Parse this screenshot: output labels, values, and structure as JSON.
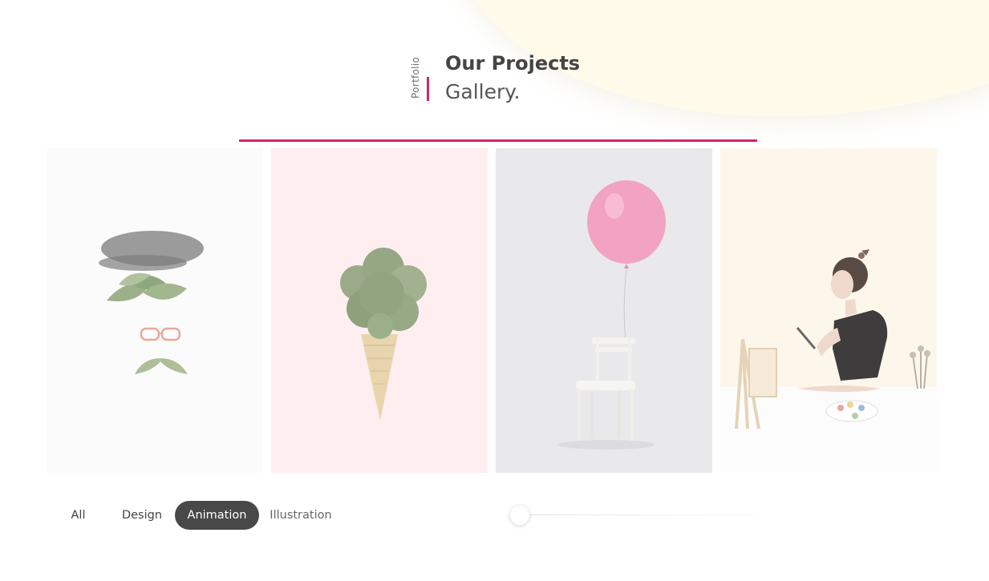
{
  "heading": {
    "vertical_label": "Portfolio",
    "title": "Our Projects",
    "subtitle": "Gallery."
  },
  "colors": {
    "accent": "#d4246f",
    "active_filter_bg": "#484848",
    "blob": "#fffaea"
  },
  "gallery": {
    "items": [
      {
        "icon": "beret-leaves-glasses-mustache-image"
      },
      {
        "icon": "broccoli-ice-cream-cone-image"
      },
      {
        "icon": "pink-balloon-chair-image"
      },
      {
        "icon": "woman-painting-easel-image"
      }
    ]
  },
  "filters": {
    "items": [
      {
        "label": "All",
        "active": false
      },
      {
        "label": "Design",
        "active": false
      },
      {
        "label": "Animation",
        "active": true
      },
      {
        "label": "Illustration",
        "active": false
      }
    ]
  },
  "slider": {
    "position": 0
  }
}
